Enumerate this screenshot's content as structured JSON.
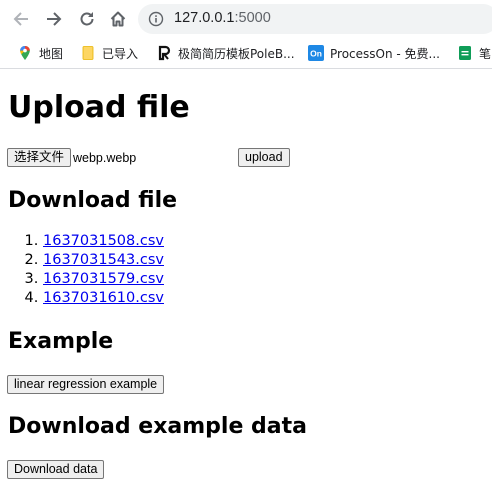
{
  "browser": {
    "url_host": "127.0.0.1",
    "url_port": ":5000",
    "icons": [
      "back-arrow-icon",
      "forward-arrow-icon",
      "reload-icon",
      "home-icon",
      "info-icon"
    ]
  },
  "bookmarks": [
    {
      "label": "地图",
      "icon": "google-maps-icon"
    },
    {
      "label": "已导入",
      "icon": "folder-icon"
    },
    {
      "label": "极简简历模板PoleB...",
      "icon": "poleb-icon"
    },
    {
      "label": "ProcessOn - 免费...",
      "icon": "processon-icon"
    },
    {
      "label": "笔",
      "icon": "green-sheet-icon"
    }
  ],
  "page": {
    "upload_heading": "Upload file",
    "choose_file_label": "选择文件",
    "chosen_file_name": "webp.webp",
    "upload_button": "upload",
    "download_heading": "Download file",
    "files": [
      "1637031508.csv",
      "1637031543.csv",
      "1637031579.csv",
      "1637031610.csv"
    ],
    "example_heading": "Example",
    "example_button": "linear regression example",
    "example_data_heading": "Download example data",
    "download_data_button": "Download data"
  },
  "colors": {
    "link": "#0000ee",
    "omnibox_bg": "#f1f3f4",
    "button_bg": "#efefef"
  }
}
